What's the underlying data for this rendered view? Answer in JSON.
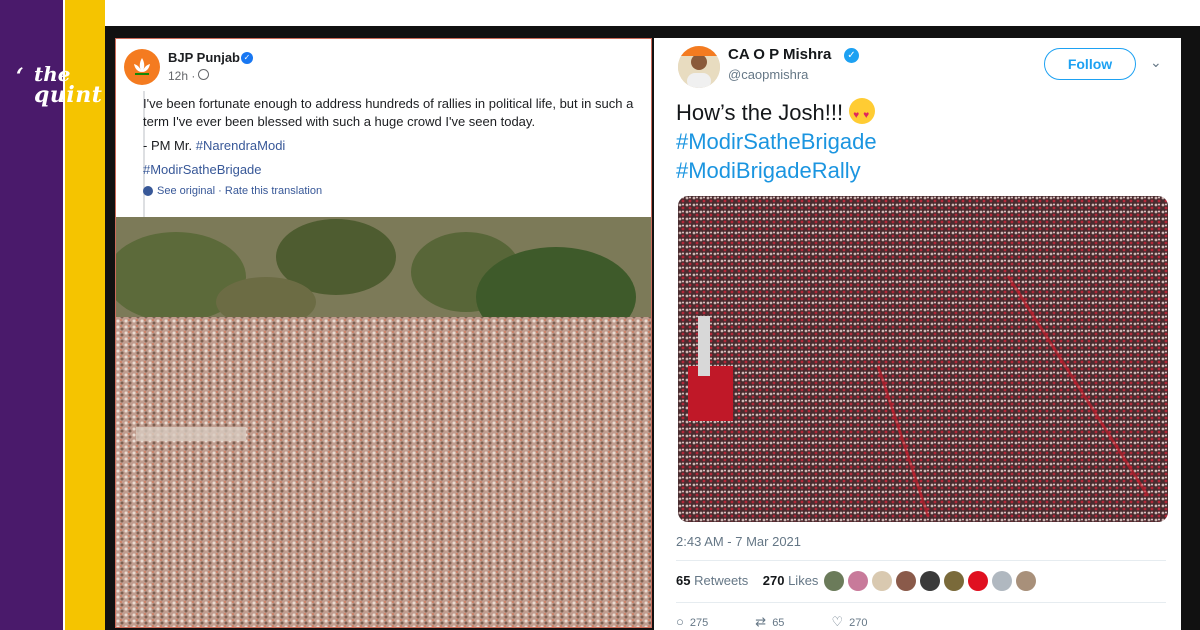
{
  "brand": {
    "logo_line1": "the",
    "logo_line2": "quint",
    "colors": {
      "purple": "#4a1a6b",
      "yellow": "#f5c400"
    }
  },
  "facebook_post": {
    "page_name": "BJP Punjab",
    "verified": true,
    "time": "12h ·",
    "text_line1": "I've been fortunate enough to address hundreds of rallies in political life, but in such a",
    "text_line2": "term I've ever been blessed with such a huge crowd I've seen today.",
    "attribution_prefix": "- PM Mr. ",
    "attribution_tag": "#NarendraModi",
    "hashtag": "#ModirSatheBrigade",
    "see_original": "See original",
    "separator": " · ",
    "rate_translation": "Rate this translation",
    "icons": [
      "verified-icon",
      "globe-icon",
      "gear-icon"
    ],
    "image": "crowd-photo"
  },
  "tweet": {
    "display_name": "CA O P Mishra",
    "handle": "@caopmishra",
    "verified": true,
    "follow_label": "Follow",
    "caret": "⌄",
    "text": "How’s the Josh!!!",
    "hashtag1": "#ModirSatheBrigade",
    "hashtag2": "#ModiBrigadeRally",
    "date": "2:43 AM - 7 Mar 2021",
    "retweets_count": "65",
    "retweets_label": "Retweets",
    "likes_count": "270",
    "likes_label": "Likes",
    "reply_count": "275",
    "retweet_action_count": "65",
    "like_action_count": "270",
    "liker_colors": [
      "#6b7b5a",
      "#c87a9a",
      "#d9c9b0",
      "#8a5a4a",
      "#3a3a3a",
      "#7a6a3a",
      "#e01020",
      "#b0b8c0",
      "#a8907a"
    ],
    "icons": [
      "verified-icon",
      "chevron-down-icon",
      "heart-eyes-emoji",
      "reply-icon",
      "retweet-icon",
      "heart-icon"
    ],
    "image": "crowd-photo"
  }
}
